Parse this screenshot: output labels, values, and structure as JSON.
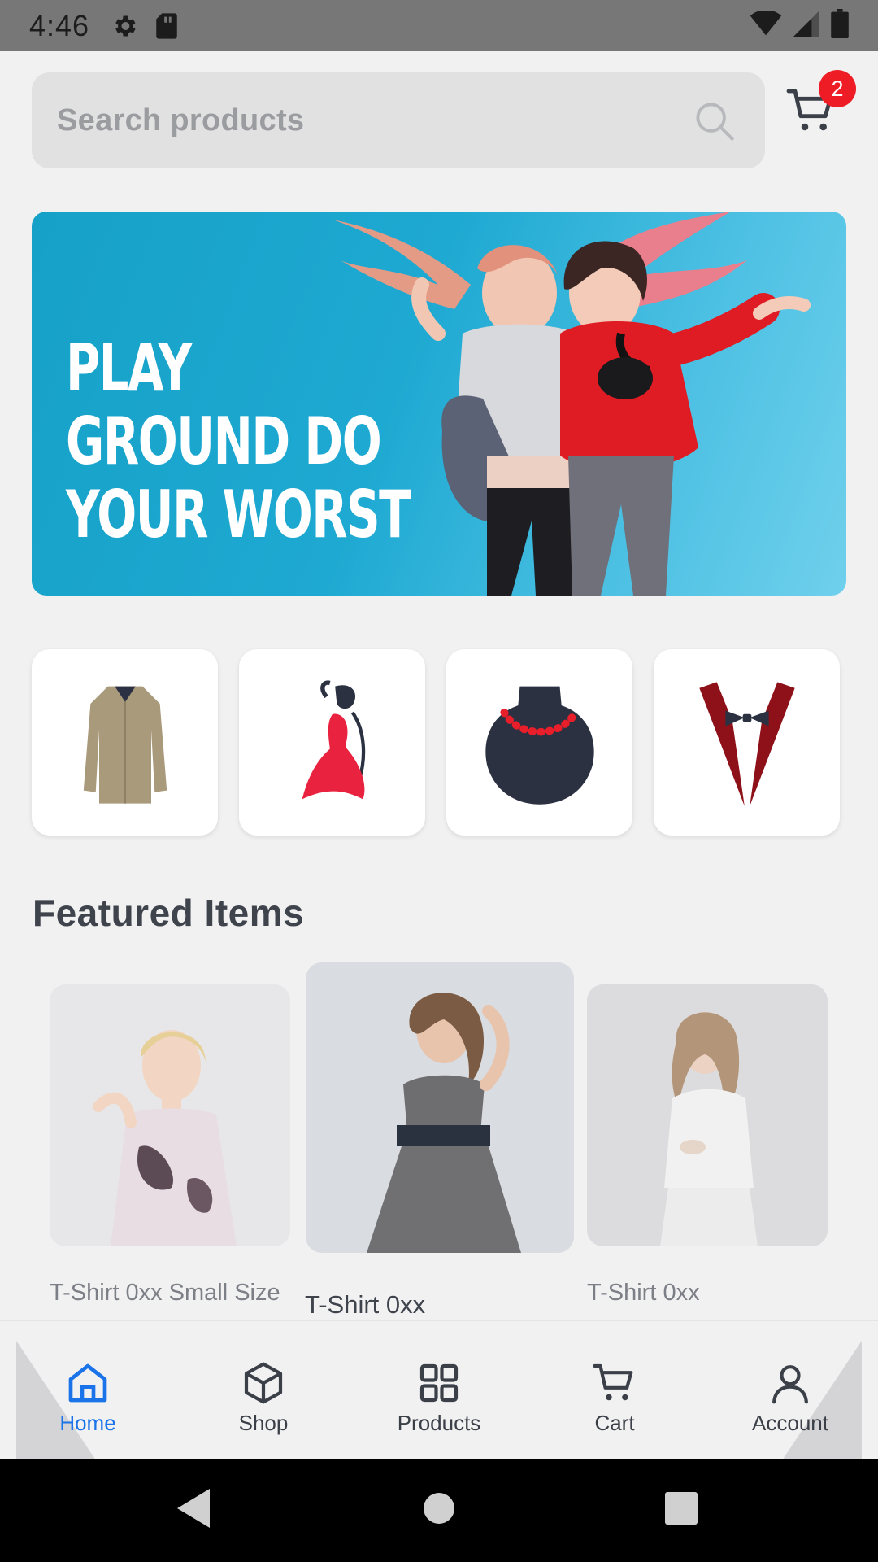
{
  "status_bar": {
    "time": "4:46"
  },
  "search": {
    "placeholder": "Search products"
  },
  "cart": {
    "badge_count": "2"
  },
  "banner": {
    "line1": "PLAY",
    "line2": "GROUND DO",
    "line3": "YOUR WORST"
  },
  "categories": [
    {
      "icon": "coat-icon"
    },
    {
      "icon": "dress-icon"
    },
    {
      "icon": "necklace-icon"
    },
    {
      "icon": "tuxedo-icon"
    }
  ],
  "featured": {
    "title": "Featured Items",
    "products": [
      {
        "name": "T-Shirt 0xx Small Size"
      },
      {
        "name": "T-Shirt 0xx"
      },
      {
        "name": "T-Shirt 0xx"
      }
    ]
  },
  "bottom_nav": {
    "items": [
      {
        "label": "Home",
        "icon": "home-icon"
      },
      {
        "label": "Shop",
        "icon": "cube-icon"
      },
      {
        "label": "Products",
        "icon": "grid-icon"
      },
      {
        "label": "Cart",
        "icon": "cart-icon"
      },
      {
        "label": "Account",
        "icon": "person-icon"
      }
    ],
    "active_color": "#1a73e8"
  }
}
